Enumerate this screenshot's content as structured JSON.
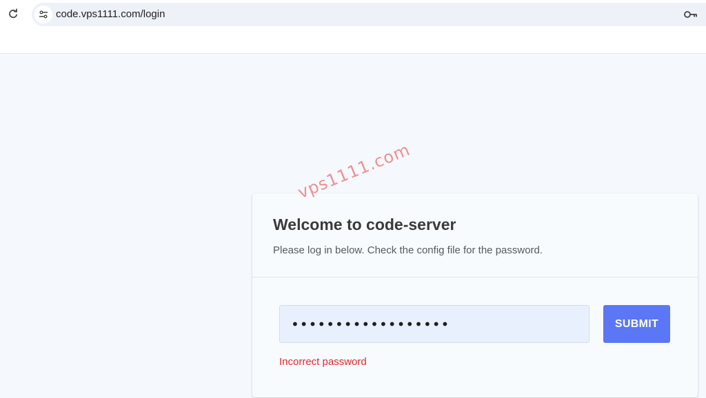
{
  "browser": {
    "url": "code.vps1111.com/login",
    "icons": {
      "reload": "reload-icon",
      "site_info": "site-info-icon",
      "password_key": "key-icon"
    }
  },
  "watermark": "vps1111.com",
  "login_card": {
    "title": "Welcome to code-server",
    "subtitle": "Please log in below. Check the config file for the password.",
    "password_value": "••••••••••••••••••",
    "submit_label": "SUBMIT",
    "error_text": "Incorrect password"
  },
  "colors": {
    "page_background": "#f5f8fc",
    "submit_button": "#5b77f5",
    "error_text": "#e0282e",
    "password_field": "#e9f0fd"
  }
}
